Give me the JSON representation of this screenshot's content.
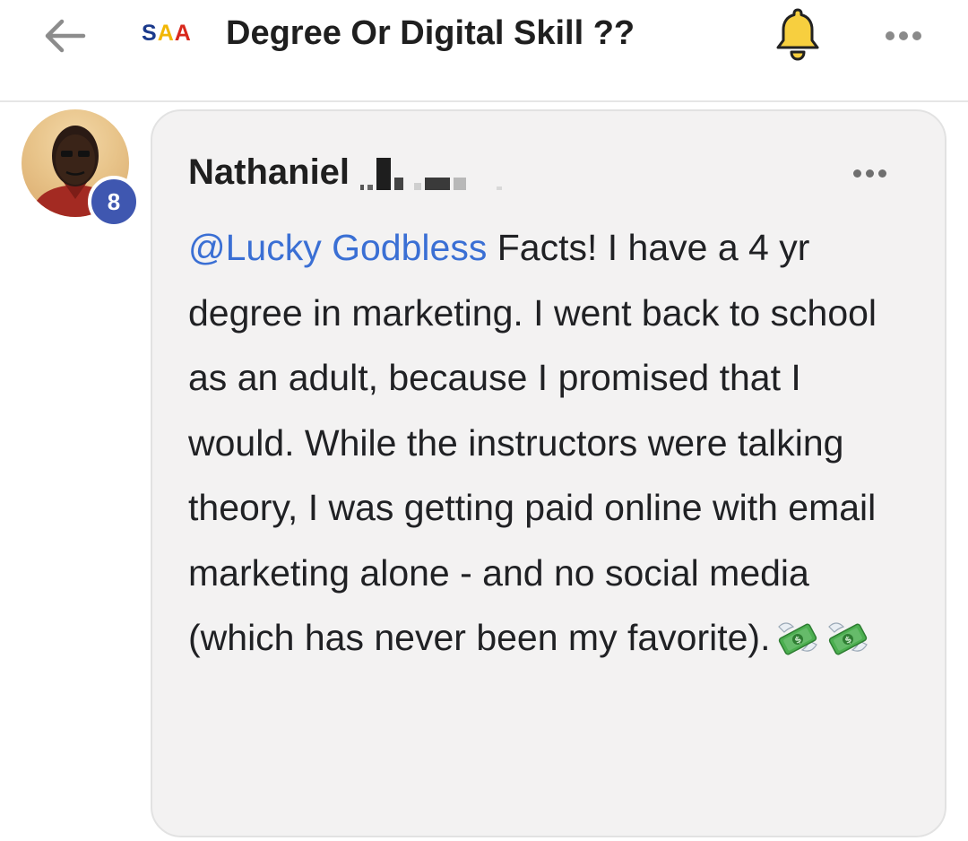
{
  "header": {
    "logo_text": [
      "S",
      "A",
      "A"
    ],
    "title": "Degree Or Digital Skill ??",
    "colors": {
      "logo_s": "#1b3a8c",
      "logo_a1": "#f2b705",
      "logo_a2": "#d8281c",
      "bell": "#f7cf3f"
    }
  },
  "comment": {
    "author_name": "Nathaniel",
    "author_badge_level": "8",
    "mention": "@Lucky Godbless",
    "body": " Facts! I have a 4 yr degree in marketing. I went back to school as an adult, because I promised that I would. While the instructors were talking theory, I was getting paid online with email marketing alone - and no social media (which has never been my favorite).",
    "emojis": [
      "money-with-wings",
      "money-with-wings"
    ],
    "colors": {
      "mention": "#3a6fd4",
      "badge": "#3f57b0",
      "bubble_bg": "#f3f2f2"
    }
  }
}
